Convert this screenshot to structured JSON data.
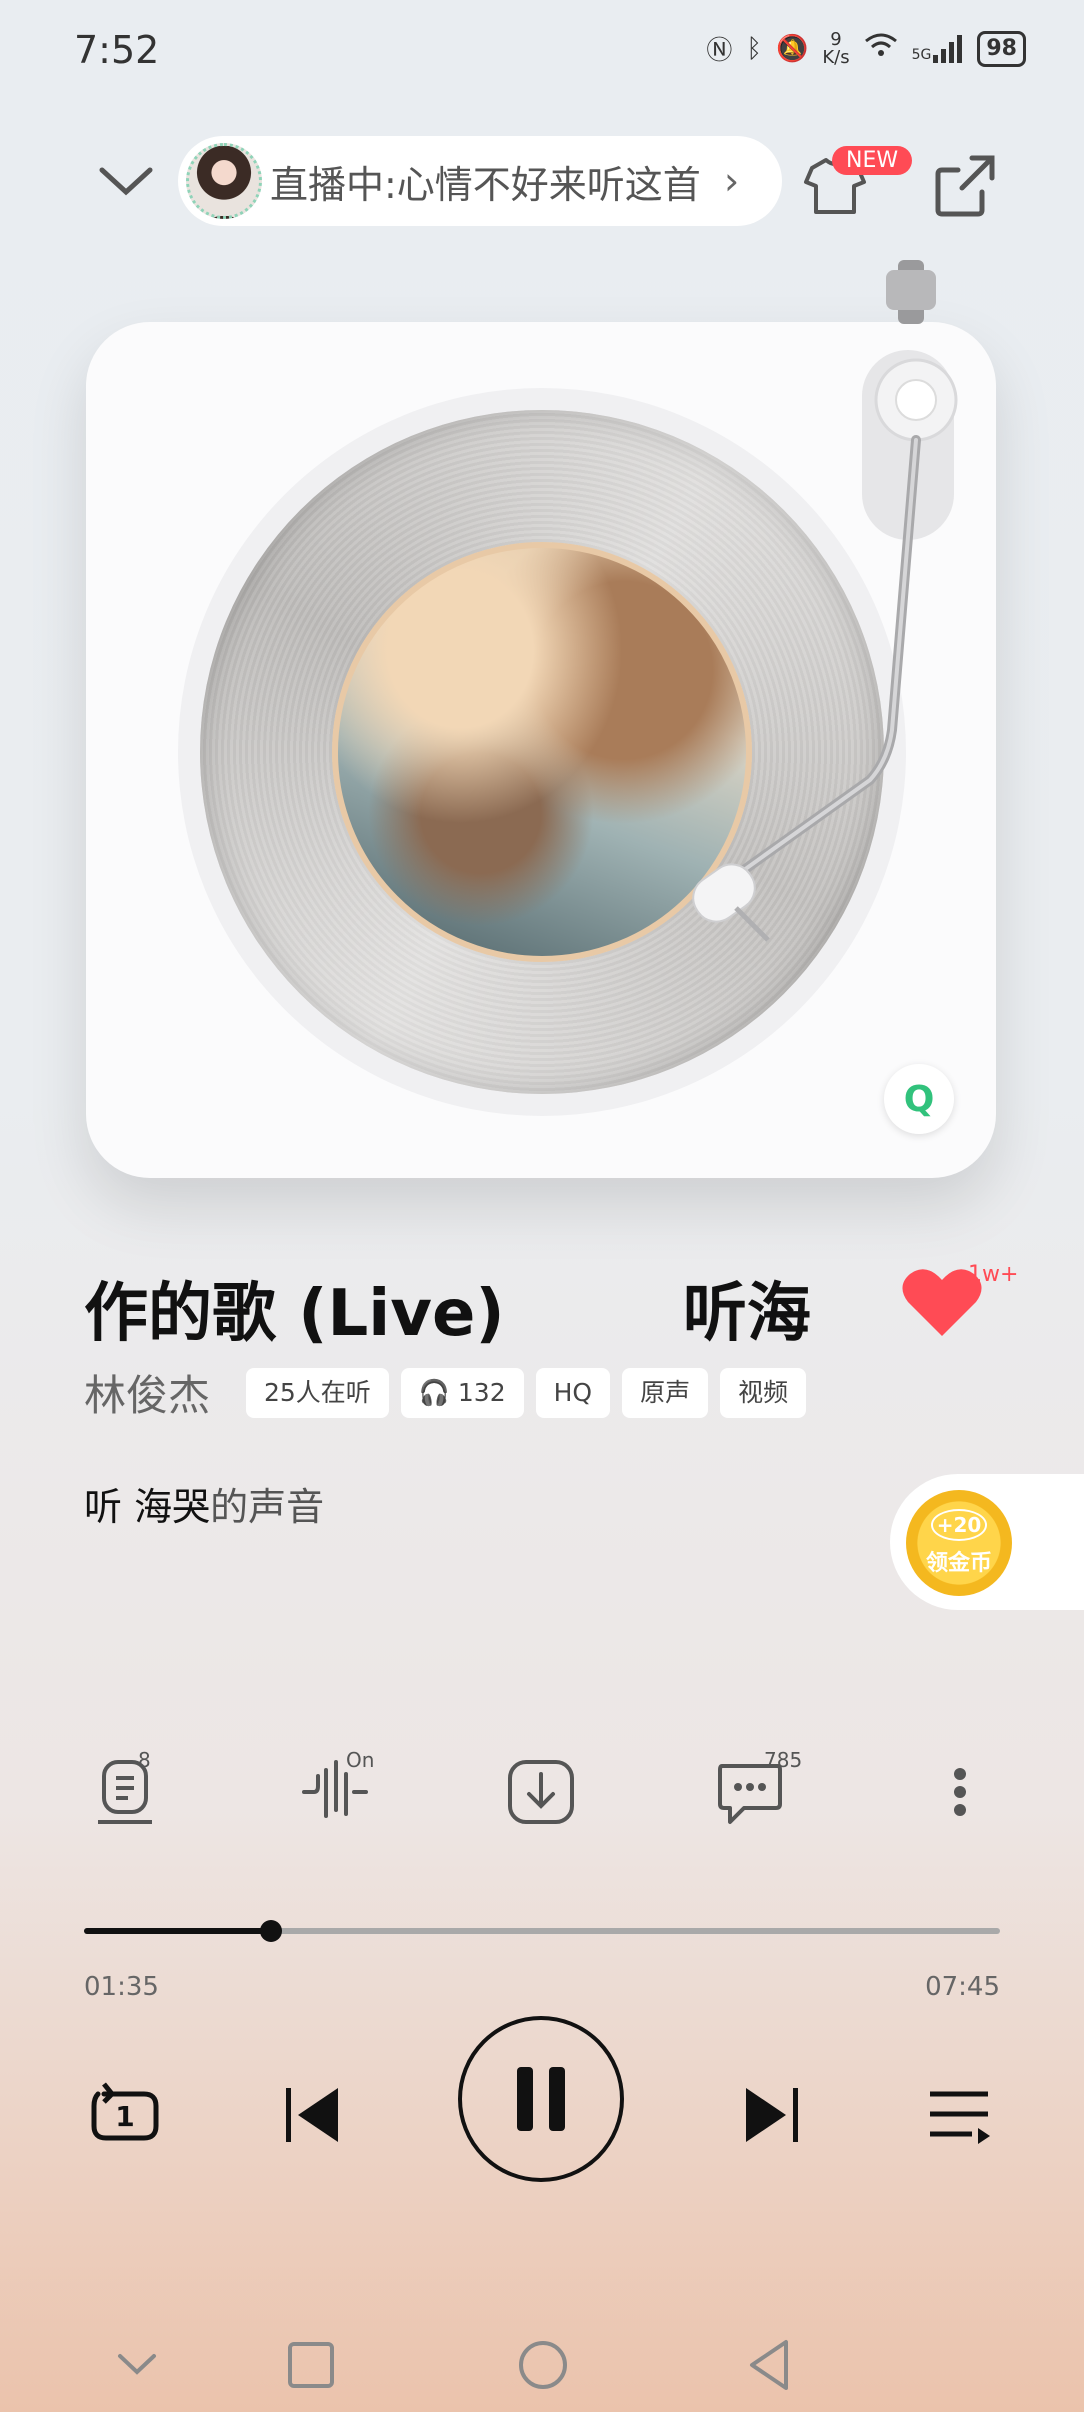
{
  "status_bar": {
    "time": "7:52",
    "net_speed_top": "9",
    "net_speed_unit": "K/s",
    "signal_label": "5G",
    "battery": "98"
  },
  "header": {
    "live_label": "直播中:心情不好来听这首",
    "new_badge": "NEW"
  },
  "song": {
    "title": "作的歌 (Live)        听海",
    "like_count": "1w+",
    "artist": "林俊杰",
    "tags": [
      "25人在听",
      "132",
      "HQ",
      "原声",
      "视频"
    ]
  },
  "lyric": {
    "highlighted": "听 海哭",
    "rest": "的声音"
  },
  "coin": {
    "plus": "+20",
    "label": "领金币"
  },
  "actions": {
    "lyrics_badge": "8",
    "effect_badge": "On",
    "comment_badge": "785"
  },
  "progress": {
    "current": "01:35",
    "total": "07:45",
    "fraction": 0.204
  },
  "colors": {
    "accent_red": "#ff4b55",
    "qq_green": "#31c27c",
    "coin_yellow": "#ffd54a"
  }
}
